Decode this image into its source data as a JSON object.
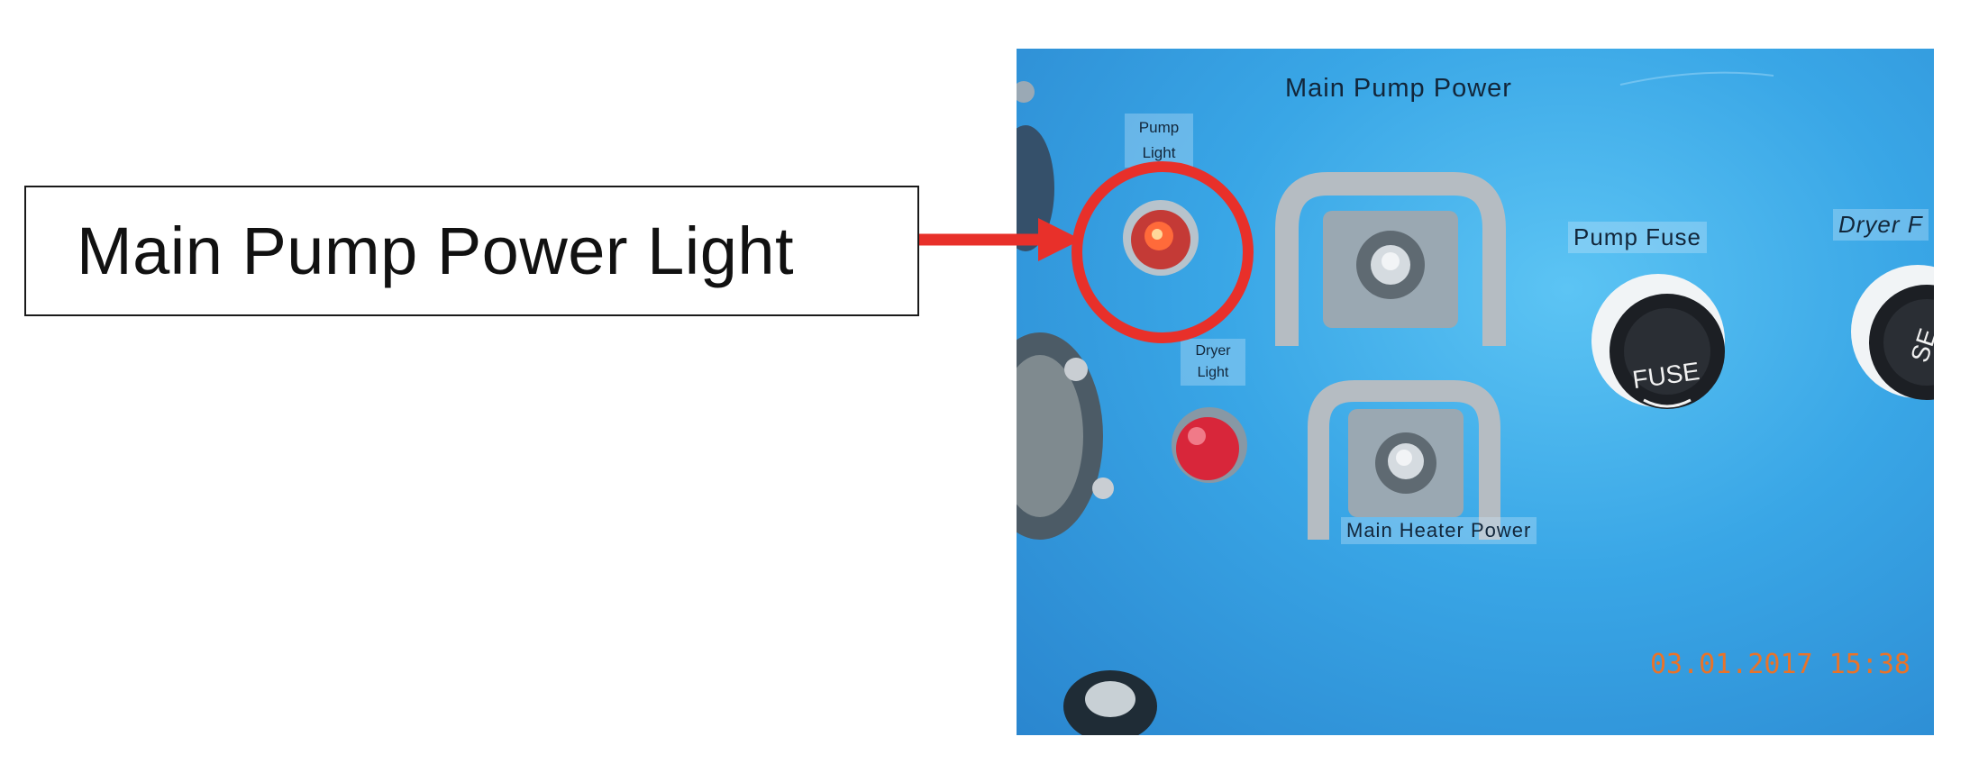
{
  "callout": {
    "text": "Main Pump Power Light"
  },
  "panel_labels": {
    "main_pump_power": "Main Pump Power",
    "pump_light": "Pump\nLight",
    "dryer_light": "Dryer\nLight",
    "pump_fuse": "Pump Fuse",
    "dryer_fuse": "Dryer F",
    "main_heater_power": "Main Heater Power",
    "fuse_cap": "FUSE"
  },
  "timestamp": "03.01.2017 15:38",
  "colors": {
    "highlight": "#e8302a",
    "panel_blue": "#39a6e6",
    "timestamp": "#e8732a"
  }
}
